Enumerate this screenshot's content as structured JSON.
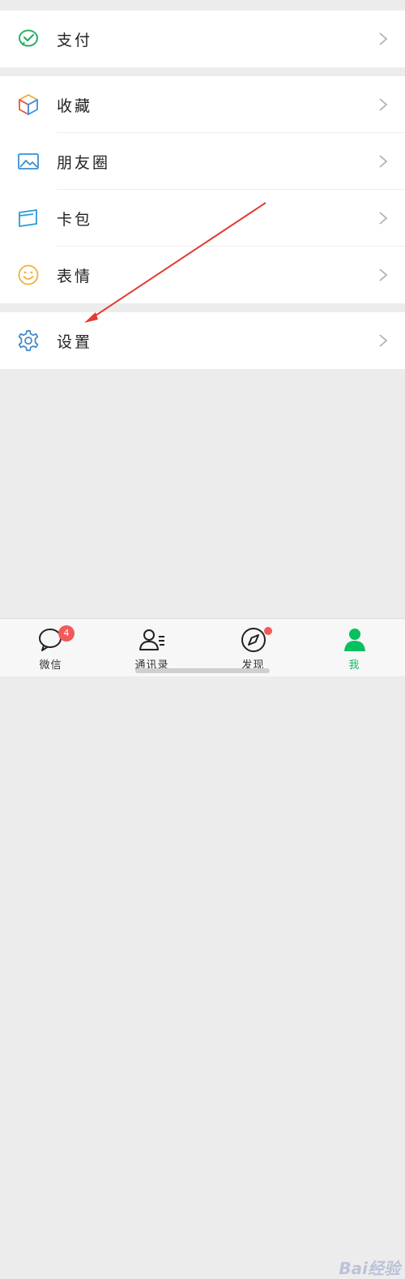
{
  "menu": {
    "pay": {
      "label": "支付",
      "icon": "wechat-pay-icon"
    },
    "favorites": {
      "label": "收藏",
      "icon": "cube-icon"
    },
    "moments": {
      "label": "朋友圈",
      "icon": "image-icon"
    },
    "cards": {
      "label": "卡包",
      "icon": "card-icon"
    },
    "stickers": {
      "label": "表情",
      "icon": "smiley-icon"
    },
    "settings": {
      "label": "设置",
      "icon": "gear-icon"
    }
  },
  "tabbar": {
    "chats": {
      "label": "微信",
      "badge": "4"
    },
    "contacts": {
      "label": "通讯录"
    },
    "discover": {
      "label": "发现"
    },
    "me": {
      "label": "我"
    }
  },
  "colors": {
    "accent_green": "#07c160",
    "badge_red": "#f25a5a",
    "annotation_arrow": "#e53935"
  },
  "watermark": "Bai经验"
}
